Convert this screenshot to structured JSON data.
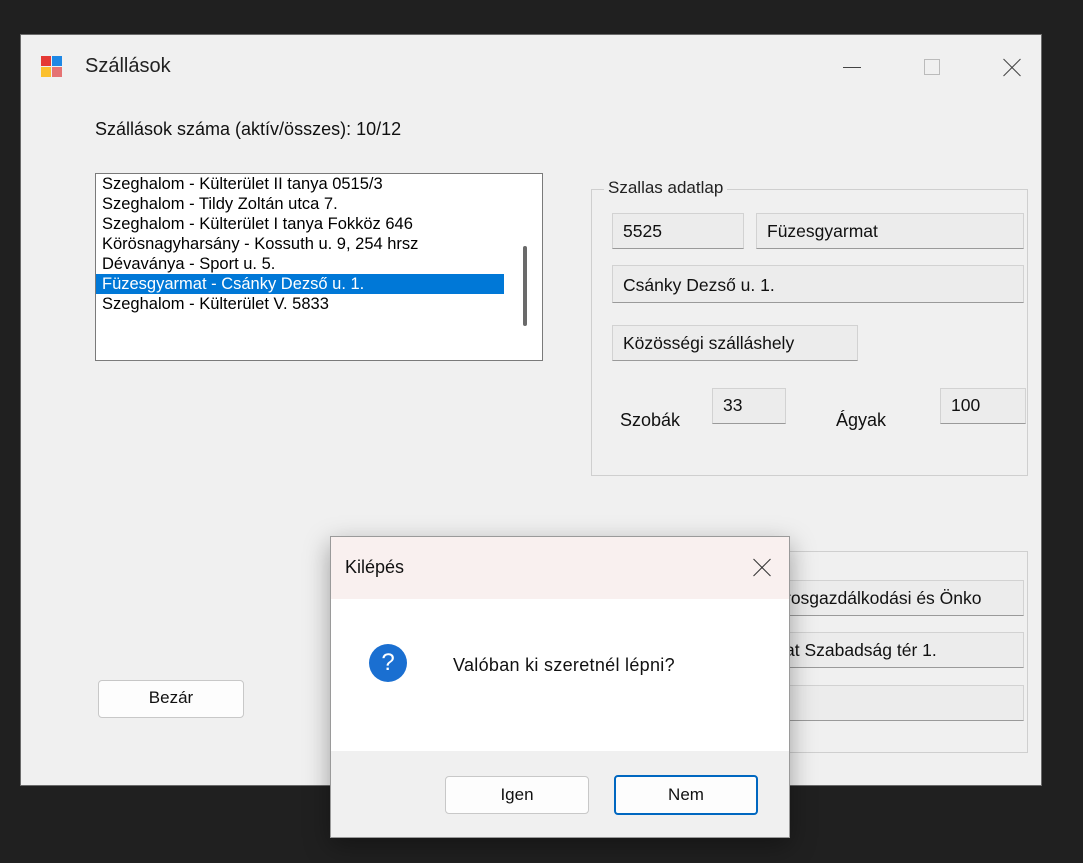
{
  "window": {
    "title": "Szállások",
    "controls": {
      "minimize_icon": "minimize-icon",
      "maximize_icon": "maximize-icon",
      "close_icon": "close-icon"
    }
  },
  "main": {
    "count_label": "Szállások száma (aktív/összes): 10/12",
    "list": {
      "items": [
        "Szeghalom -  Külterület II tanya 0515/3",
        "Szeghalom -  Tildy Zoltán utca 7.",
        "Szeghalom -  Külterület I tanya Fokköz 646",
        "Körösnagyharsány -  Kossuth u. 9, 254 hrsz",
        "Dévaványa -  Sport u. 5.",
        "Füzesgyarmat - Csánky Dezső u. 1.",
        "Szeghalom -  Külterület V. 5833"
      ],
      "selected_index": 5
    },
    "close_button": "Bezár"
  },
  "detail": {
    "group_title": "Szallas adatlap",
    "zip": "5525",
    "city": "Füzesgyarmat",
    "address": "Csánky Dezső u. 1.",
    "type": "Közösségi szálláshely",
    "rooms_label": "Szobák",
    "rooms": "33",
    "beds_label": "Ágyak",
    "beds": "100"
  },
  "owner": {
    "name_partial": "rosgazdálkodási és Önko",
    "address_partial": "at Szabadság tér 1.",
    "extra": ""
  },
  "dialog": {
    "title": "Kilépés",
    "icon": "question-icon",
    "message": "Valóban ki szeretnél lépni?",
    "yes_label": "Igen",
    "no_label": "Nem",
    "icon_glyph": "?"
  },
  "colors": {
    "selection": "#0078d7",
    "question_icon": "#1a6fd1",
    "primary_button_border": "#0067c0",
    "dialog_titlebar": "#f9f0ef"
  }
}
